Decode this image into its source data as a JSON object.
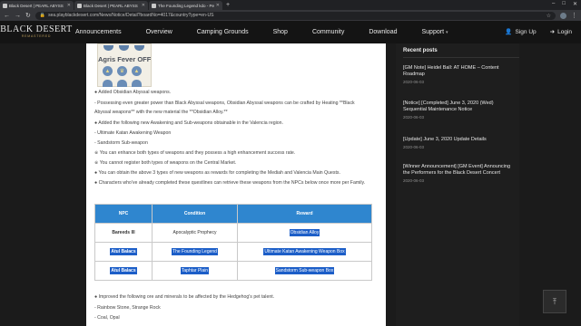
{
  "browser": {
    "tabs": [
      {
        "title": "Black Desert | PEARL ABYSS"
      },
      {
        "title": "Black Desert | PEARL ABYSS"
      },
      {
        "title": "The Founding Legend kdo - Pe..."
      }
    ],
    "new_tab": "+",
    "url": "sea.playblackdesert.com/News/Notice/Detail?boardNo=4017&countryType=en-US",
    "window_controls": [
      "–",
      "□",
      "✕"
    ]
  },
  "site": {
    "logo_main": "BLACK DESERT",
    "logo_sub": "REMASTERED",
    "menu": [
      {
        "label": "Announcements"
      },
      {
        "label": "Overview"
      },
      {
        "label": "Camping Grounds"
      },
      {
        "label": "Shop"
      },
      {
        "label": "Community"
      },
      {
        "label": "Download"
      },
      {
        "label": "Support"
      }
    ],
    "sign_up": "Sign Up",
    "login": "Login"
  },
  "banner": {
    "title": "Agris Fever OFF"
  },
  "content": {
    "lines": [
      "● Added Obsidian Abyssal weapons.",
      "- Possessing even greater power than Black Abyssal weapons, Obsidian Abyssal weapons can be crafted by Heating **Black",
      "Abyssal weapons** with the new material the **Obsidian Alloy.**",
      "● Added the following new Awakening and Sub-weapons obtainable in the Valencia region.",
      "- Ultimate Katan Awakening Weapon",
      "- Sandstorm Sub-weapon",
      "※ You can enhance both types of weapons and they possess a high enhancement success rate.",
      "※ You cannot register both types of weapons on the Central Market.",
      "● You can obtain the above 3 types of new weapons as rewards for completing the Mediah and Valencia Main Quests.",
      "● Characters who've already completed these questlines can retrieve these weapons from the NPCs below once more per Family."
    ],
    "table": {
      "headers": [
        "NPC",
        "Condition",
        "Reward"
      ],
      "rows": [
        {
          "npc": "Bareeds III",
          "condition": "Apocalyptic Prophecy",
          "reward": "Obsidian Alloy"
        },
        {
          "npc": "Atul Balacs",
          "condition": "The Founding Legend",
          "reward": "Ultimate Katan Awakening Weapon Box"
        },
        {
          "npc": "Atul Balacs",
          "condition": "Taphtar Plain",
          "reward": "Sandstorm Sub-weapon Box"
        }
      ]
    },
    "after_lines": [
      "● Improved the following ore and minerals to be affected by the Hedgehog's pet talent.",
      "- Rainbow Stone, Strange Rock",
      "- Coal, Opal"
    ]
  },
  "sidebar": {
    "title": "Recent posts",
    "posts": [
      {
        "title": "[GM Note] Heidel Ball: AT HOME – Content Roadmap",
        "date": "2020-06-03"
      },
      {
        "title": "[Notice] [Completed] June 3, 2020 (Wed) Sequential Maintenance Notice",
        "date": "2020-06-03"
      },
      {
        "title": "[Update] June 3, 2020 Update Details",
        "date": "2020-06-03"
      },
      {
        "title": "[Winner Announcement] [GM Event] Announcing the Performers for the Black Desert Concert",
        "date": "2020-06-03"
      }
    ]
  },
  "scroll_top": "⤒"
}
